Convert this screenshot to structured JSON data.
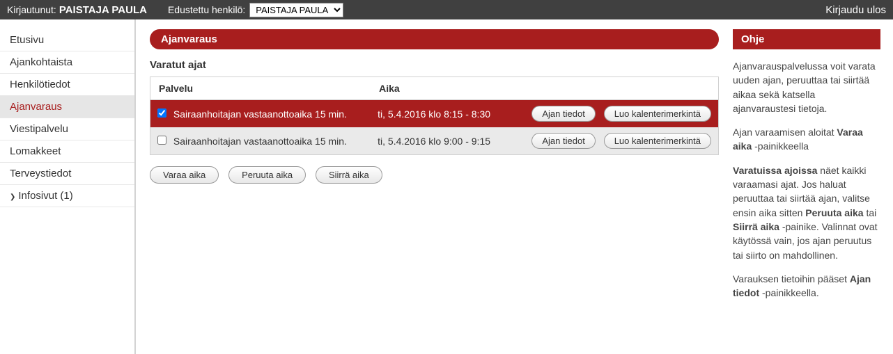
{
  "topbar": {
    "logged_in_label": "Kirjautunut:",
    "logged_in_name": "PAISTAJA PAULA",
    "represented_label": "Edustettu henkilö:",
    "represented_value": "PAISTAJA PAULA",
    "logout": "Kirjaudu ulos"
  },
  "sidebar": {
    "items": [
      {
        "label": "Etusivu",
        "active": false
      },
      {
        "label": "Ajankohtaista",
        "active": false
      },
      {
        "label": "Henkilötiedot",
        "active": false
      },
      {
        "label": "Ajanvaraus",
        "active": true
      },
      {
        "label": "Viestipalvelu",
        "active": false
      },
      {
        "label": "Lomakkeet",
        "active": false
      },
      {
        "label": "Terveystiedot",
        "active": false
      },
      {
        "label": "Infosivut (1)",
        "active": false,
        "arrow": true
      }
    ]
  },
  "main": {
    "title": "Ajanvaraus",
    "subheading": "Varatut ajat",
    "columns": {
      "service": "Palvelu",
      "time": "Aika"
    },
    "rows": [
      {
        "checked": true,
        "service": "Sairaanhoitajan vastaanottoaika 15 min.",
        "time": "ti, 5.4.2016 klo 8:15 - 8:30",
        "btn_details": "Ajan tiedot",
        "btn_cal": "Luo kalenterimerkintä"
      },
      {
        "checked": false,
        "service": "Sairaanhoitajan vastaanottoaika 15 min.",
        "time": "ti, 5.4.2016 klo 9:00 - 9:15",
        "btn_details": "Ajan tiedot",
        "btn_cal": "Luo kalenterimerkintä"
      }
    ],
    "actions": {
      "book": "Varaa aika",
      "cancel": "Peruuta aika",
      "move": "Siirrä aika"
    }
  },
  "help": {
    "title": "Ohje",
    "p1_a": "Ajanvarauspalvelussa voit varata uuden ajan, peruuttaa tai siirtää aikaa sekä katsella ajanvaraustesi tietoja.",
    "p2_a": "Ajan varaamisen aloitat ",
    "p2_b": "Varaa aika",
    "p2_c": " -painikkeella",
    "p3_a": "Varatuissa ajoissa",
    "p3_b": " näet kaikki varaamasi ajat. Jos haluat peruuttaa tai siirtää ajan, valitse ensin aika sitten ",
    "p3_c": "Peruuta aika",
    "p3_d": " tai ",
    "p3_e": "Siirrä aika",
    "p3_f": " -painike. Valinnat ovat käytössä vain, jos ajan peruutus tai siirto on mahdollinen.",
    "p4_a": "Varauksen tietoihin pääset ",
    "p4_b": "Ajan tiedot",
    "p4_c": " -painikkeella."
  }
}
